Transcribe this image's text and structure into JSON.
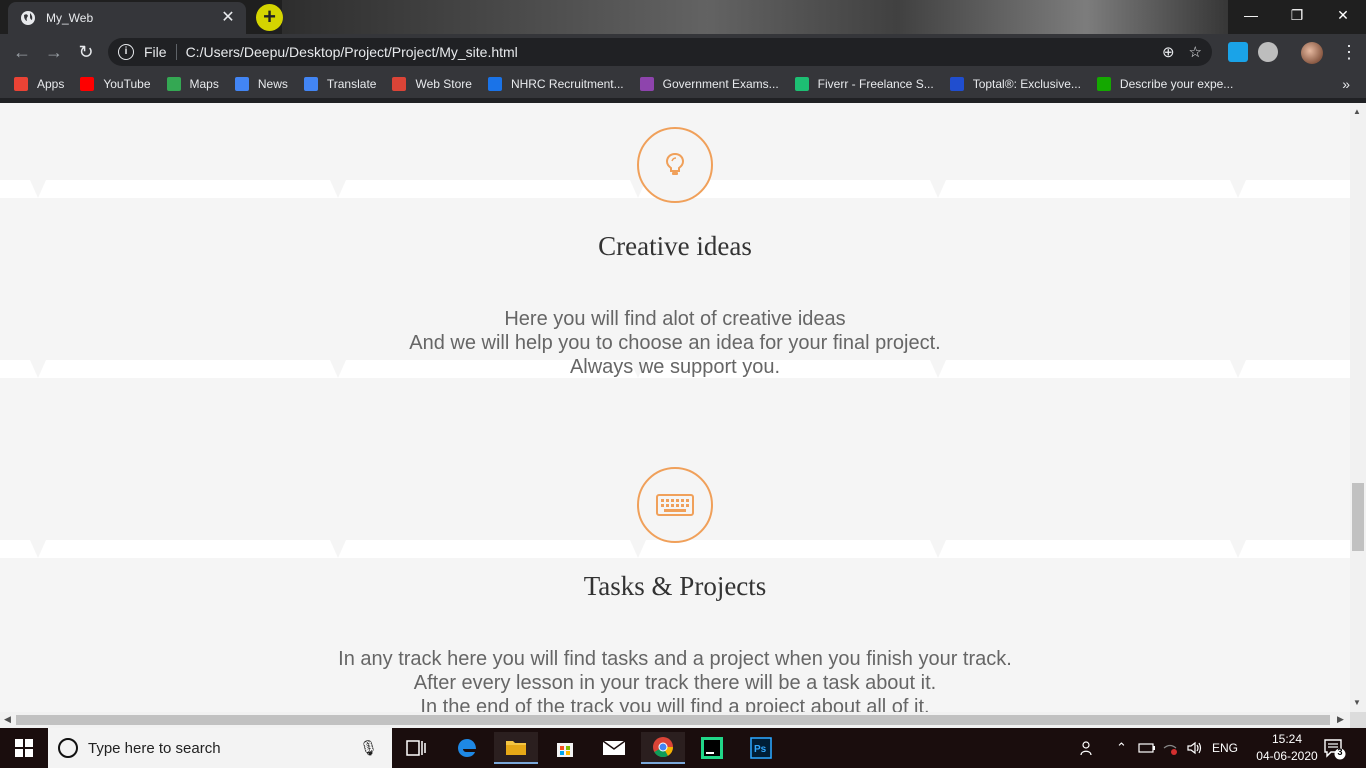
{
  "browser": {
    "tab_title": "My_Web",
    "file_label": "File",
    "url": "C:/Users/Deepu/Desktop/Project/Project/My_site.html",
    "window_controls": {
      "minimize": "—",
      "restore": "❐",
      "close": "✕"
    }
  },
  "bookmarks": [
    {
      "label": "Apps",
      "icon": "apps-grid-icon",
      "color": "#ea4335"
    },
    {
      "label": "YouTube",
      "icon": "youtube-icon",
      "color": "#ff0000"
    },
    {
      "label": "Maps",
      "icon": "maps-icon",
      "color": "#34a853"
    },
    {
      "label": "News",
      "icon": "news-icon",
      "color": "#4285f4"
    },
    {
      "label": "Translate",
      "icon": "translate-icon",
      "color": "#4285f4"
    },
    {
      "label": "Web Store",
      "icon": "web-store-icon",
      "color": "#db4437"
    },
    {
      "label": "NHRC Recruitment...",
      "icon": "nhrc-icon",
      "color": "#1a73e8"
    },
    {
      "label": "Government Exams...",
      "icon": "gov-exams-icon",
      "color": "#8e44ad"
    },
    {
      "label": "Fiverr - Freelance S...",
      "icon": "fiverr-icon",
      "color": "#1dbf73"
    },
    {
      "label": "Toptal®: Exclusive...",
      "icon": "toptal-icon",
      "color": "#204ecf"
    },
    {
      "label": "Describe your expe...",
      "icon": "upwork-icon",
      "color": "#14a800"
    }
  ],
  "page": {
    "accent_color": "#f0a05a",
    "sections": [
      {
        "icon": "lightbulb-icon",
        "title": "Creative ideas",
        "lines": [
          "Here you will find alot of creative ideas",
          "And we will help you to choose an idea for your final project.",
          "Always we support you."
        ]
      },
      {
        "icon": "keyboard-icon",
        "title": "Tasks & Projects",
        "lines": [
          "In any track here you will find tasks and a project when you finish your track.",
          "After every lesson in your track there will be a task about it.",
          "In the end of the track you will find a project about all of it."
        ]
      }
    ]
  },
  "taskbar": {
    "search_placeholder": "Type here to search",
    "language": "ENG",
    "time": "15:24",
    "date": "04-06-2020",
    "notification_count": "3"
  }
}
